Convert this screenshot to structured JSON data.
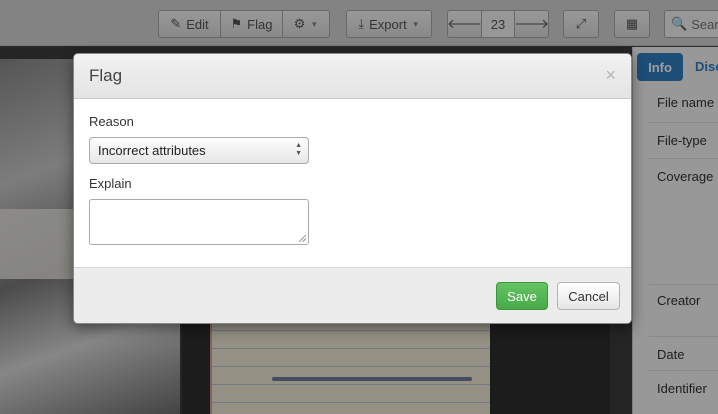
{
  "toolbar": {
    "edit_label": "Edit",
    "flag_label": "Flag",
    "export_label": "Export",
    "page_number": "23",
    "search_placeholder": "Searc"
  },
  "sidebar": {
    "tab_info": "Info",
    "tab_discussion": "Disc",
    "fields": [
      "File name",
      "File-type",
      "Coverage",
      "Creator",
      "Date",
      "Identifier"
    ]
  },
  "modal": {
    "title": "Flag",
    "close_glyph": "×",
    "reason_label": "Reason",
    "reason_selected": "Incorrect attributes",
    "explain_label": "Explain",
    "explain_value": "",
    "save_label": "Save",
    "cancel_label": "Cancel"
  },
  "colors": {
    "save_button": "#5cb85c",
    "info_tab": "#2f7fc1"
  }
}
